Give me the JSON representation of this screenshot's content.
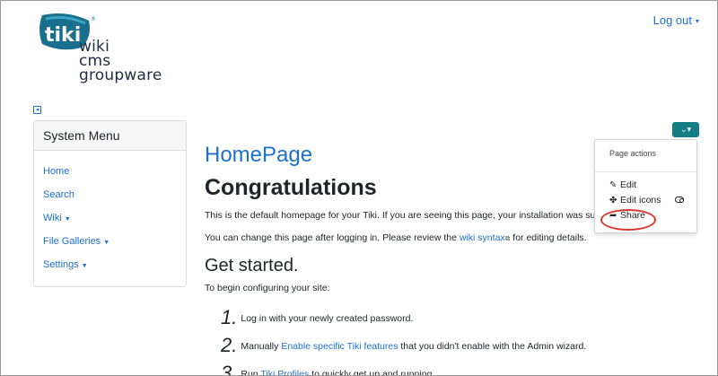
{
  "logo": {
    "badge": "tiki",
    "line1": "wiki",
    "line2": "cms",
    "line3": "groupware",
    "colors": {
      "badge": "#1a6f8e",
      "text": "#1f2c44"
    }
  },
  "header": {
    "logout_label": "Log out"
  },
  "sidebar": {
    "title": "System Menu",
    "items": [
      {
        "label": "Home",
        "dropdown": false
      },
      {
        "label": "Search",
        "dropdown": false
      },
      {
        "label": "Wiki",
        "dropdown": true
      },
      {
        "label": "File Galleries",
        "dropdown": true
      },
      {
        "label": "Settings",
        "dropdown": true
      }
    ]
  },
  "main": {
    "page_title": "HomePage",
    "heading": "Congratulations",
    "intro": "This is the default homepage for your Tiki. If you are seeing this page, your installation was su",
    "change_before": "You can change this page after logging in. Please review the ",
    "change_link": "wiki syntax",
    "change_after": " for editing details.",
    "get_started": "Get started.",
    "configure": "To begin configuring your site:",
    "steps": [
      {
        "num": "1.",
        "before": "Log in with your newly created password.",
        "link": "",
        "after": ""
      },
      {
        "num": "2.",
        "before": "Manually ",
        "link": "Enable specific Tiki features",
        "after": " that you didn't enable with the Admin wizard."
      },
      {
        "num": "3.",
        "before": "Run ",
        "link": "Tiki Profiles",
        "after": " to quickly get up and running."
      }
    ]
  },
  "page_actions": {
    "header": "Page actions",
    "items": [
      {
        "label": "Edit",
        "icon": "edit-icon"
      },
      {
        "label": "Edit icons",
        "icon": "puzzle-icon"
      },
      {
        "label": "Share",
        "icon": "share-icon"
      }
    ],
    "button_color": "#157d84",
    "highlight_color": "#e0362c"
  }
}
